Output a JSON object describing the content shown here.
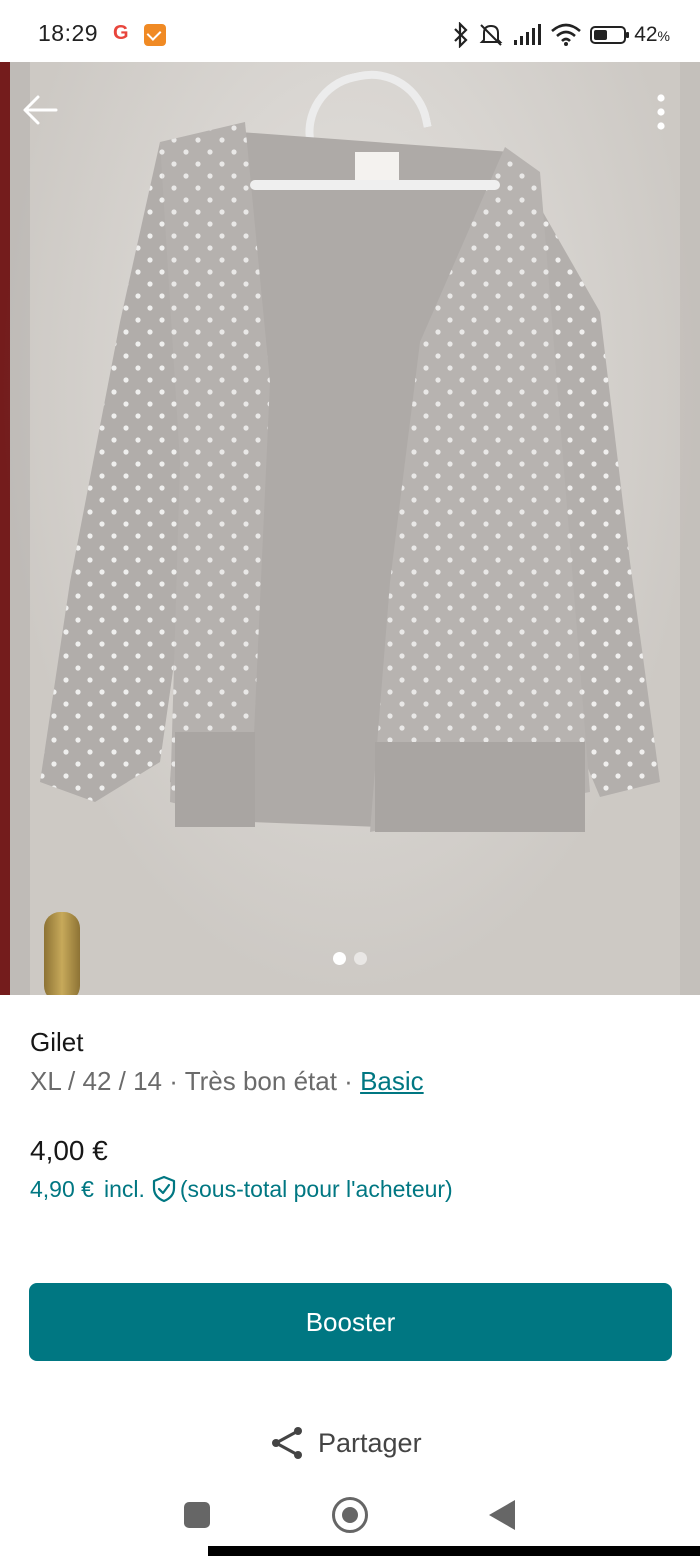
{
  "status_bar": {
    "time": "18:29",
    "battery": "42",
    "battery_unit": "%"
  },
  "gallery": {
    "image_count": 2,
    "active_index": 0
  },
  "item": {
    "title": "Gilet",
    "size": "XL / 42 / 14",
    "separator": "·",
    "condition": "Très bon état",
    "brand": "Basic",
    "price": "4,00 €",
    "total_price": "4,90 €",
    "incl": "incl.",
    "total_note": "(sous-total pour l'acheteur)"
  },
  "actions": {
    "booster": "Booster",
    "share": "Partager"
  },
  "colors": {
    "accent": "#007782",
    "text": "#171717",
    "muted": "#6b6b6b"
  },
  "icons": {
    "back": "arrow-left-icon",
    "more": "more-vertical-icon",
    "shield": "shield-check-icon",
    "share": "share-icon"
  }
}
